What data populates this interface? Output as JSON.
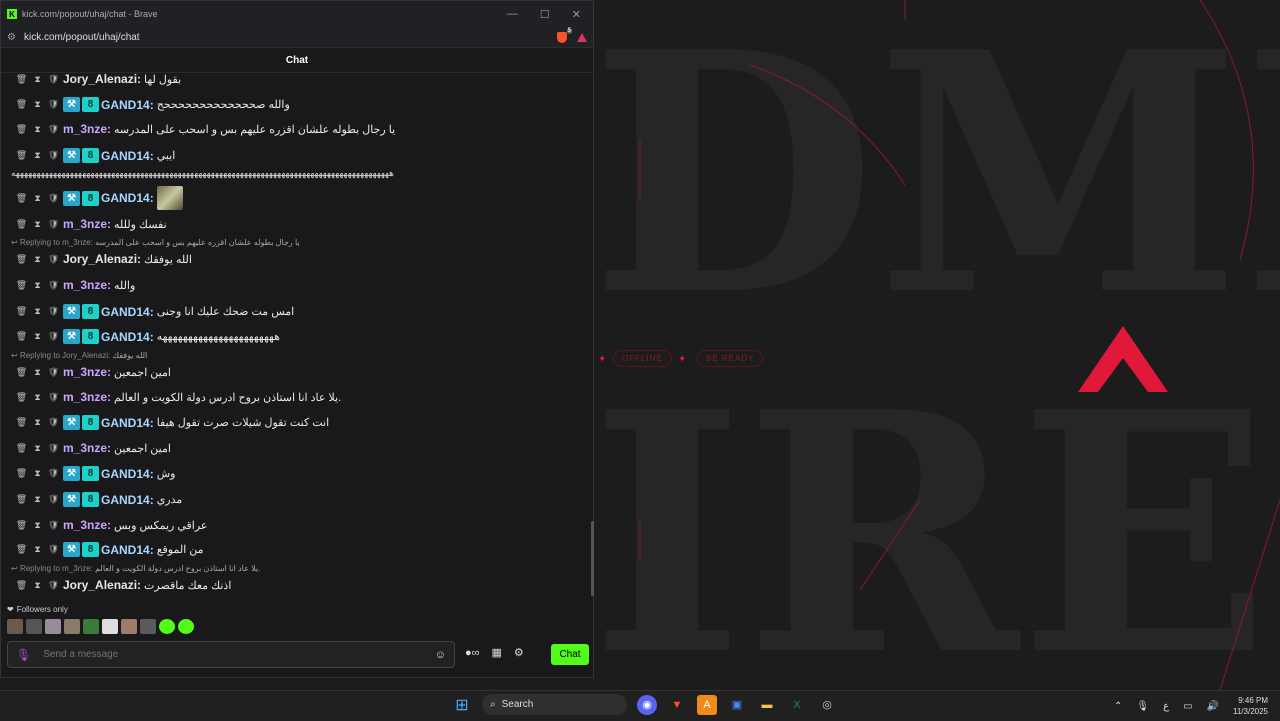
{
  "window": {
    "title": "kick.com/popout/uhaj/chat - Brave",
    "url": "kick.com/popout/uhaj/chat",
    "controls": [
      "—",
      "☐",
      "✕"
    ]
  },
  "chat": {
    "header": "Chat",
    "messages": [
      {
        "user": "Jory_Alenazi",
        "sep": ":",
        "text": "بقول لها",
        "badges": false
      },
      {
        "user": "GAND14",
        "sep": ":",
        "text": "والله صحححححححححححححح",
        "badges": true
      },
      {
        "user": "m_3nze",
        "sep": ":",
        "text": "يا رجال بطوله علشان اقزره عليهم بس و اسحب على المدرسه",
        "badges": false
      },
      {
        "user": "GAND14",
        "sep": ":",
        "text": "ايبي",
        "badges": true
      },
      {
        "user": "GAND14",
        "sep": ":",
        "text": "",
        "badges": true,
        "emote": "meme-emote"
      },
      {
        "user": "m_3nze",
        "sep": ":",
        "text": "نفسك وللله",
        "badges": false
      },
      {
        "user": "Jory_Alenazi",
        "sep": ":",
        "text": "الله يوفقك",
        "badges": false
      },
      {
        "user": "m_3nze",
        "sep": ":",
        "text": "والله",
        "badges": false
      },
      {
        "user": "GAND14",
        "sep": ":",
        "text": "امس مت ضحك عليك انا وجنى",
        "badges": true
      },
      {
        "user": "GAND14",
        "sep": ":",
        "text": "هههههههههههههههههههههههه",
        "badges": true
      },
      {
        "user": "m_3nze",
        "sep": ":",
        "text": "امين اجمعين",
        "badges": false
      },
      {
        "user": "m_3nze",
        "sep": ":",
        "text": "يلا عاد انا استاذن بروح ادرس دولة الكويت و العالم.",
        "badges": false
      },
      {
        "user": "GAND14",
        "sep": ":",
        "text": "انت كنت تقول شيلات صرت تقول هيفا",
        "badges": true
      },
      {
        "user": "m_3nze",
        "sep": ":",
        "text": "امين اجمعين",
        "badges": false
      },
      {
        "user": "GAND14",
        "sep": ":",
        "text": "وش",
        "badges": true
      },
      {
        "user": "GAND14",
        "sep": ":",
        "text": "مدري",
        "badges": true
      },
      {
        "user": "m_3nze",
        "sep": ":",
        "text": "عراقي ريمكس وبس",
        "badges": false
      },
      {
        "user": "GAND14",
        "sep": ":",
        "text": "من الموقع",
        "badges": true
      },
      {
        "user": "Jory_Alenazi",
        "sep": ":",
        "text": "اذنك معك ماقصرت",
        "badges": false
      }
    ],
    "long_line": "هههههههههههههههههههههههههههههههههههههههههههههههههههههههههههههههههههههههههههههههههههههههههههه",
    "replies": [
      {
        "label": "Replying to m_3nze:",
        "quote": "يا رجال بطوله علشان اقزره عليهم بس و اسحب على المدرسه"
      },
      {
        "label": "Replying to Jory_Alenazi:",
        "quote": "الله يوفقك"
      },
      {
        "label": "Replying to m_3nze:",
        "quote": "يلا عاد انا استاذن بروح ادرس دولة الكويت و العالم."
      }
    ],
    "followers_only": "Followers only",
    "input_placeholder": "Send a message",
    "chat_button": "Chat"
  },
  "stream_bg": {
    "pill_left": "OFFLINE",
    "pill_right": "BE READY",
    "big_top": "DME",
    "big_bottom": "IRE"
  },
  "taskbar": {
    "search": "Search",
    "time": "9:46 PM",
    "date": "11/3/2025",
    "lang": "ع"
  },
  "colors": {
    "kick_green": "#53fc18",
    "accent_red": "#e0183a"
  }
}
